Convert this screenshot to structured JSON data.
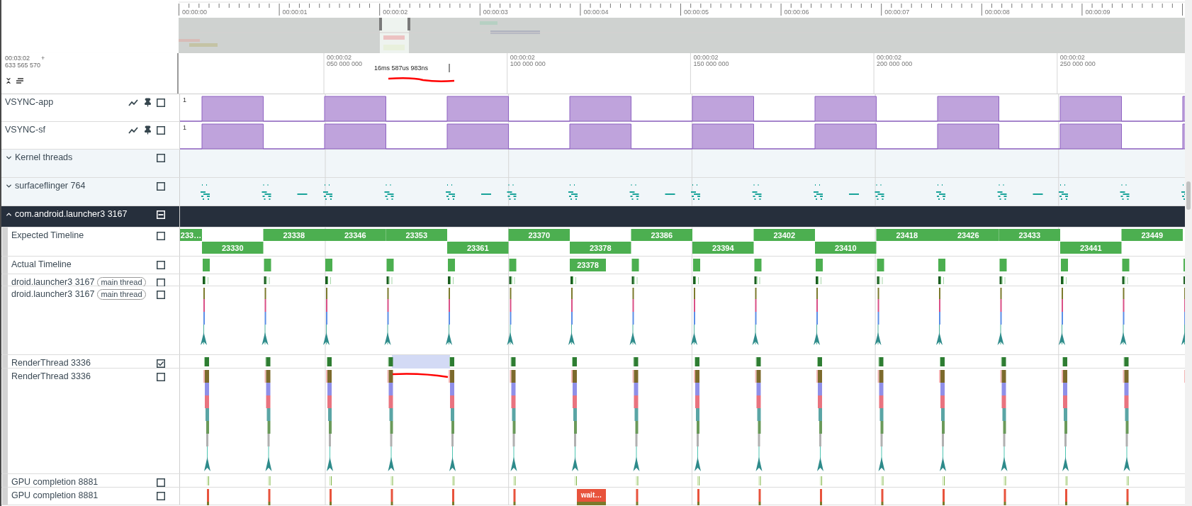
{
  "ruler": {
    "labels": [
      "00:00:00",
      "00:00:01",
      "00:00:02",
      "00:00:03",
      "00:00:04",
      "00:00:05",
      "00:00:06",
      "00:00:07",
      "00:00:08",
      "00:00:09"
    ]
  },
  "time_header": {
    "offset_time": "00:03:02",
    "offset_plus": "+",
    "offset_ns": "633 565 570",
    "selection_duration": "16ms 587us 983ns",
    "ticks": [
      {
        "time": "00:00:02",
        "ns": "050 000 000"
      },
      {
        "time": "00:00:02",
        "ns": "100 000 000"
      },
      {
        "time": "00:00:02",
        "ns": "150 000 000"
      },
      {
        "time": "00:00:02",
        "ns": "200 000 000"
      },
      {
        "time": "00:00:02",
        "ns": "250 000 000"
      }
    ]
  },
  "tracks": [
    {
      "kind": "counter",
      "name": "VSYNC-app",
      "value_label": "1",
      "checked": false
    },
    {
      "kind": "counter",
      "name": "VSYNC-sf",
      "value_label": "1",
      "checked": false
    },
    {
      "kind": "group",
      "name": "Kernel threads",
      "expanded": false,
      "checked": false
    },
    {
      "kind": "process_summary",
      "name": "surfaceflinger 764",
      "expanded": false,
      "checked": false
    },
    {
      "kind": "process",
      "name": "com.android.launcher3 3167",
      "expanded": true,
      "partially_checked": true,
      "children": [
        {
          "kind": "expected_timeline",
          "name": "Expected Timeline",
          "checked": false,
          "frames": [
            {
              "label": "233…",
              "upper": true
            },
            {
              "label": "23330",
              "upper": false
            },
            {
              "label": "23338",
              "upper": true
            },
            {
              "label": "23346",
              "upper": true
            },
            {
              "label": "23353",
              "upper": true
            },
            {
              "label": "23361",
              "upper": false
            },
            {
              "label": "23370",
              "upper": true
            },
            {
              "label": "23378",
              "upper": false
            },
            {
              "label": "23386",
              "upper": true
            },
            {
              "label": "23394",
              "upper": false
            },
            {
              "label": "23402",
              "upper": true
            },
            {
              "label": "23410",
              "upper": false
            },
            {
              "label": "23418",
              "upper": true
            },
            {
              "label": "23426",
              "upper": true
            },
            {
              "label": "23433",
              "upper": true
            },
            {
              "label": "23441",
              "upper": false
            },
            {
              "label": "23449",
              "upper": true
            }
          ]
        },
        {
          "kind": "actual_timeline",
          "name": "Actual Timeline",
          "checked": false,
          "label": "23378"
        },
        {
          "kind": "thread_state",
          "name": "droid.launcher3 3167",
          "tag": "main thread",
          "checked": false
        },
        {
          "kind": "thread_slices",
          "name": "droid.launcher3 3167",
          "tag": "main thread",
          "checked": false
        },
        {
          "kind": "render_state",
          "name": "RenderThread 3336",
          "checked": true
        },
        {
          "kind": "render_slices",
          "name": "RenderThread 3336",
          "checked": false
        },
        {
          "kind": "gpu_state",
          "name": "GPU completion 8881",
          "checked": false
        },
        {
          "kind": "gpu_slices",
          "name": "GPU completion 8881",
          "checked": false,
          "label": "wait…"
        }
      ]
    }
  ]
}
